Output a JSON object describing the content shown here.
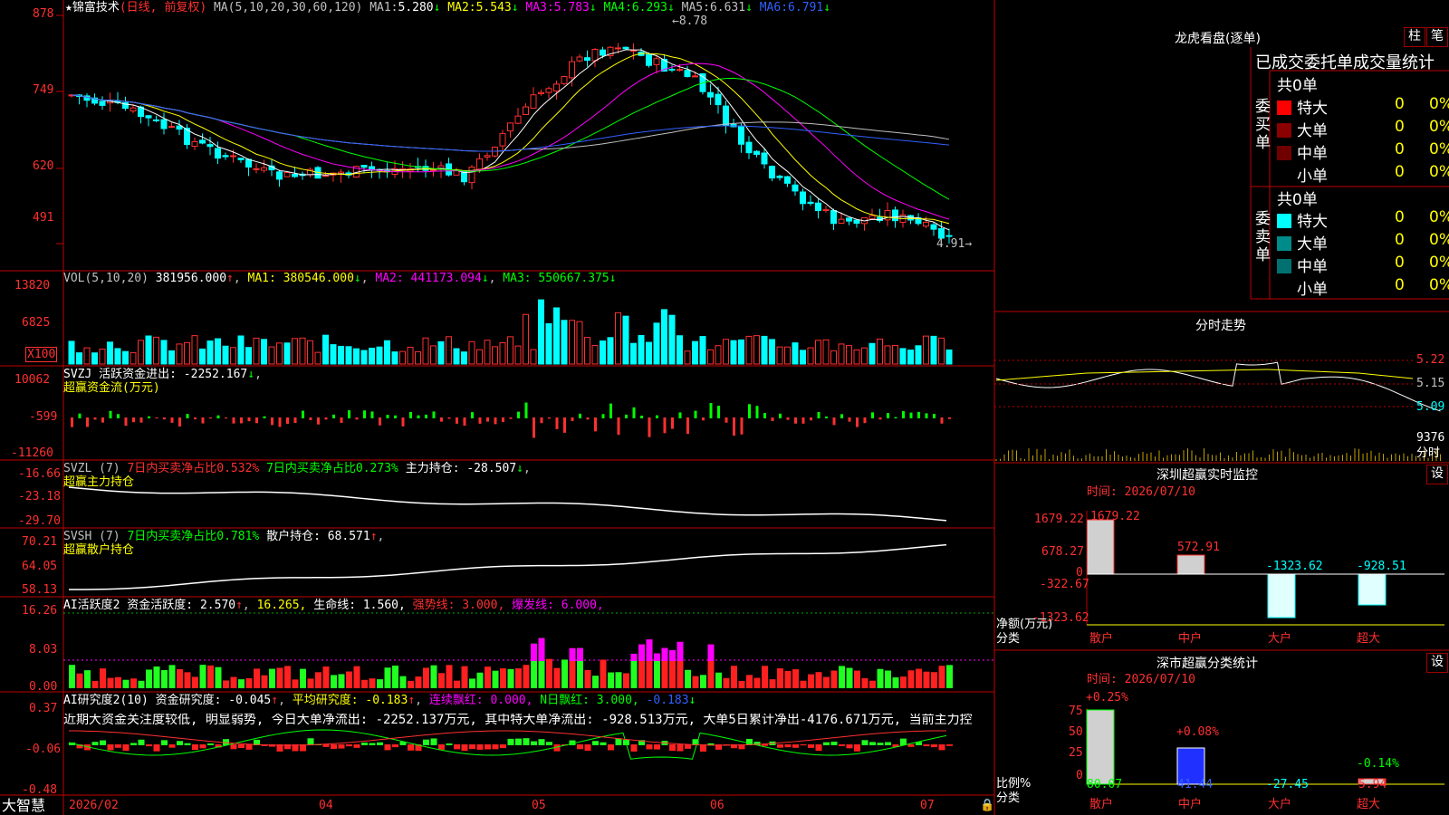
{
  "stock": {
    "name": "锦富技术",
    "mode": "(日线, 前复权)",
    "ma_params": "MA(5,10,20,30,60,120)",
    "ma": [
      {
        "label": "MA1:",
        "value": "5.280",
        "arrow": "↓"
      },
      {
        "label": "MA2:",
        "value": "5.543",
        "arrow": "↓"
      },
      {
        "label": "MA3:",
        "value": "5.783",
        "arrow": "↓"
      },
      {
        "label": "MA4:",
        "value": "6.293",
        "arrow": "↓"
      },
      {
        "label": "MA5:",
        "value": "6.631",
        "arrow": "↓"
      },
      {
        "label": "MA6:",
        "value": "6.791",
        "arrow": "↓"
      }
    ],
    "high_label": "8.78",
    "low_label": "4.91",
    "price_axis": [
      "878",
      "749",
      "620",
      "491"
    ]
  },
  "vol": {
    "header": "VOL(5,10,20)",
    "value": "381956.000",
    "ma1": "MA1: 380546.000",
    "ma2": "MA2: 441173.094",
    "ma3": "MA3: 550667.375",
    "axis": [
      "13820",
      "6825",
      "X100"
    ]
  },
  "svzj": {
    "header": "SVZJ  活跃资金进出: -2252.167",
    "subtitle": "超赢资金流(万元)",
    "axis": [
      "10062",
      "-599",
      "-11260"
    ]
  },
  "svzl": {
    "header": "SVZL (7)",
    "t1": "7日内买卖净占比0.532%",
    "t2": "7日内买卖净占比0.273%",
    "t3": "主力持仓: -28.507",
    "subtitle": "超赢主力持仓",
    "axis": [
      "-16.66",
      "-23.18",
      "-29.70"
    ]
  },
  "svsh": {
    "header": "SVSH (7)",
    "t1": "7日内买卖净占比0.781%",
    "t2": "散户持仓: 68.571",
    "subtitle": "超赢散户持仓",
    "axis": [
      "70.21",
      "64.05",
      "58.13"
    ]
  },
  "ai1": {
    "header": "AI活跃度2 资金活跃度: 2.570",
    "v2": "16.265,",
    "v3": "生命线: 1.560,",
    "v4": "强势线: 3.000,",
    "v5": "爆发线: 6.000,",
    "axis": [
      "16.26",
      "8.03",
      "0.00"
    ]
  },
  "ai2": {
    "header": "AI研究度2(10) 资金研究度: -0.045",
    "v2": "平均研究度: -0.183",
    "v3": "连续飘红: 0.000,",
    "v4": "N日飘红: 3.000,",
    "v5": "-0.183",
    "comment": "近期大资金关注度较低, 明显弱势, 今日大单净流出: -2252.137万元, 其中特大单净流出: -928.513万元, 大单5日累计净出-4176.671万元, 当前主力控",
    "axis": [
      "0.37",
      "-0.06",
      "-0.48"
    ]
  },
  "xaxis": {
    "brand": "大智慧",
    "labels": [
      "2026/02",
      "04",
      "05",
      "06",
      "07"
    ]
  },
  "lhb": {
    "title": "龙虎看盘(逐单)",
    "btn1": "柱",
    "btn2": "笔",
    "header": "已成交委托单成交量统计",
    "buy_label": "委买单",
    "sell_label": "委卖单",
    "buy_total": "共0单",
    "sell_total": "共0单",
    "buy_rows": [
      {
        "name": "特大",
        "count": "0",
        "pct": "0%",
        "color": "#ff0000"
      },
      {
        "name": "大单",
        "count": "0",
        "pct": "0%",
        "color": "#8b0000"
      },
      {
        "name": "中单",
        "count": "0",
        "pct": "0%",
        "color": "#700000"
      },
      {
        "name": "小单",
        "count": "0",
        "pct": "0%",
        "color": "#000000"
      }
    ],
    "sell_rows": [
      {
        "name": "特大",
        "count": "0",
        "pct": "0%",
        "color": "#00ffff"
      },
      {
        "name": "大单",
        "count": "0",
        "pct": "0%",
        "color": "#008b8b"
      },
      {
        "name": "中单",
        "count": "0",
        "pct": "0%",
        "color": "#007070"
      },
      {
        "name": "小单",
        "count": "0",
        "pct": "0%",
        "color": "#000000"
      }
    ]
  },
  "intraday": {
    "title": "分时走势",
    "prices": [
      "5.22",
      "5.15",
      "5.09"
    ],
    "vol": "9376",
    "unit": "分时"
  },
  "szmon": {
    "title": "深圳超赢实时监控",
    "btn": "设",
    "time": "时间: 2026/07/10",
    "axis": [
      "1679.22",
      "678.27",
      "0",
      "-322.67",
      "-1323.62"
    ],
    "unit1": "净额(万元)",
    "unit2": "分类",
    "cats": [
      "散户",
      "中户",
      "大户",
      "超大"
    ],
    "values": [
      "1679.22",
      "572.91",
      "-1323.62",
      "-928.51"
    ]
  },
  "szcls": {
    "title": "深市超赢分类统计",
    "btn": "设",
    "time": "时间: 2026/07/10",
    "axis": [
      "75",
      "50",
      "25",
      "0"
    ],
    "unit1": "比例%",
    "unit2": "分类",
    "cats": [
      "散户",
      "中户",
      "大户",
      "超大"
    ],
    "pcts": [
      "+0.25%",
      "+0.08%",
      "",
      "-0.14%"
    ],
    "values": [
      "80.07",
      "41.44",
      "-27.45",
      "5.94"
    ]
  }
}
